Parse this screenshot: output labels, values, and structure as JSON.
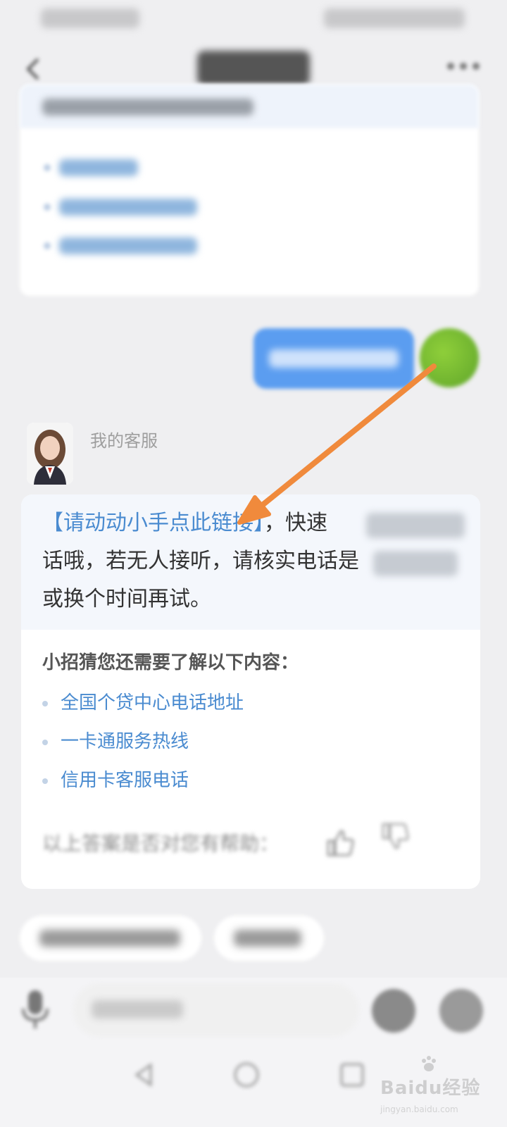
{
  "agent": {
    "name": "我的客服"
  },
  "reply": {
    "link_text": "【请动动小手点此链接】",
    "text_after_link": "，快速",
    "line2": "话哦，若无人接听，请核实电话是",
    "line3": "或换个时间再试。"
  },
  "suggestions": {
    "heading": "小招猜您还需要了解以下内容：",
    "items": [
      "全国个贷中心电话地址",
      "一卡通服务热线",
      "信用卡客服电话"
    ]
  },
  "feedback": {
    "question": "以上答案是否对您有帮助："
  },
  "watermark": {
    "brand": "Baidu经验",
    "url": "jingyan.baidu.com"
  },
  "colors": {
    "link": "#4a8bd0",
    "user_bubble": "#5b9df0",
    "arrow": "#f08a3c"
  }
}
